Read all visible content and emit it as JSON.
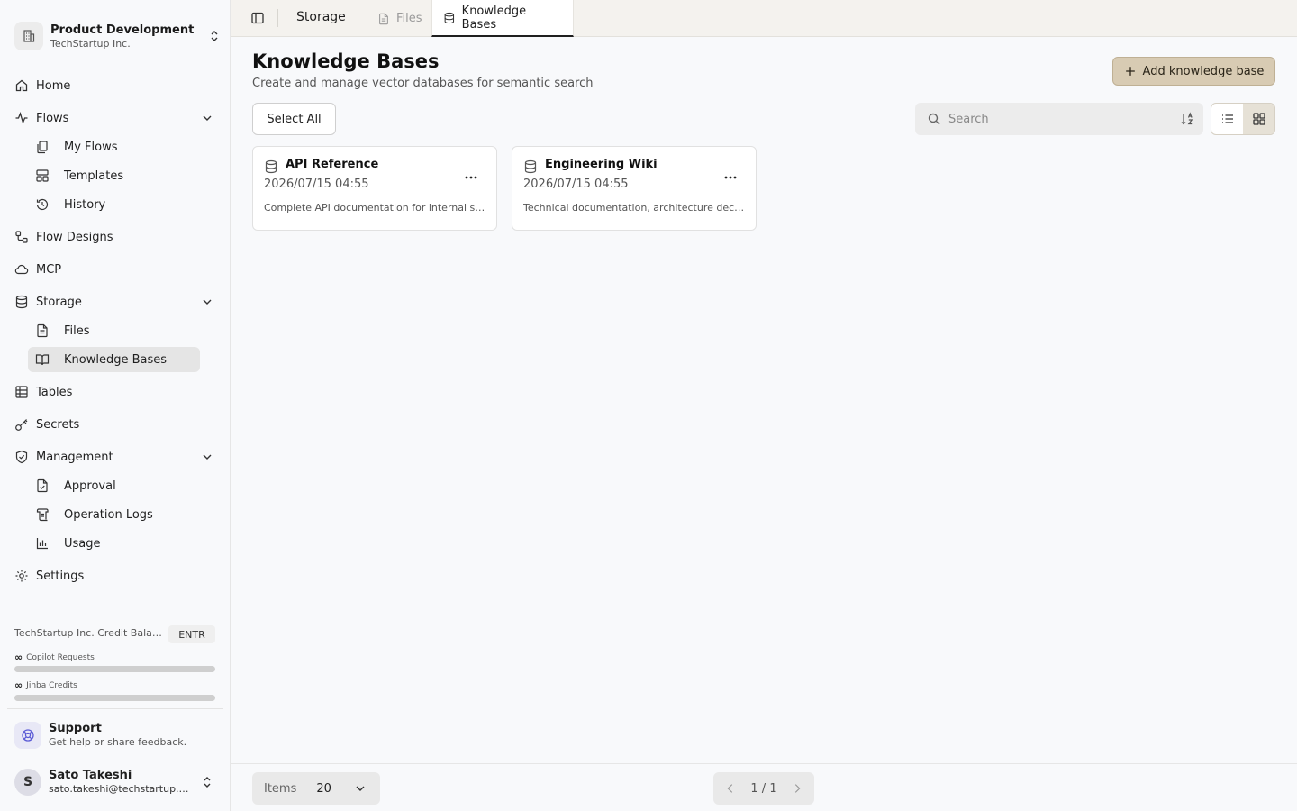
{
  "org": {
    "name": "Product Development",
    "company": "TechStartup Inc."
  },
  "nav": {
    "home": "Home",
    "flows": "Flows",
    "my_flows": "My Flows",
    "templates": "Templates",
    "history": "History",
    "flow_designs": "Flow Designs",
    "mcp": "MCP",
    "storage": "Storage",
    "files": "Files",
    "knowledge_bases": "Knowledge Bases",
    "tables": "Tables",
    "secrets": "Secrets",
    "management": "Management",
    "approval": "Approval",
    "operation_logs": "Operation Logs",
    "usage": "Usage",
    "settings": "Settings"
  },
  "credits": {
    "title": "TechStartup Inc. Credit Balance",
    "plan_badge": "ENTR",
    "meters": [
      {
        "symbol": "∞",
        "label": "Copilot Requests"
      },
      {
        "symbol": "∞",
        "label": "Jinba Credits"
      }
    ]
  },
  "support": {
    "title": "Support",
    "subtitle": "Get help or share feedback."
  },
  "user": {
    "initial": "S",
    "name": "Sato Takeshi",
    "email": "sato.takeshi@techstartup.com"
  },
  "topbar": {
    "breadcrumb": "Storage",
    "tabs": [
      {
        "label": "Files"
      },
      {
        "label": "Knowledge Bases"
      }
    ]
  },
  "page": {
    "title": "Knowledge Bases",
    "subtitle": "Create and manage vector databases for semantic search",
    "add_button": "Add knowledge base",
    "select_all": "Select All",
    "search_placeholder": "Search"
  },
  "cards": [
    {
      "title": "API Reference",
      "date": "2026/07/15 04:55",
      "description": "Complete API documentation for internal services and endpoints"
    },
    {
      "title": "Engineering Wiki",
      "date": "2026/07/15 04:55",
      "description": "Technical documentation, architecture decisions and guides"
    }
  ],
  "footer": {
    "items_label": "Items",
    "items_value": "20",
    "page_indicator": "1 / 1"
  }
}
